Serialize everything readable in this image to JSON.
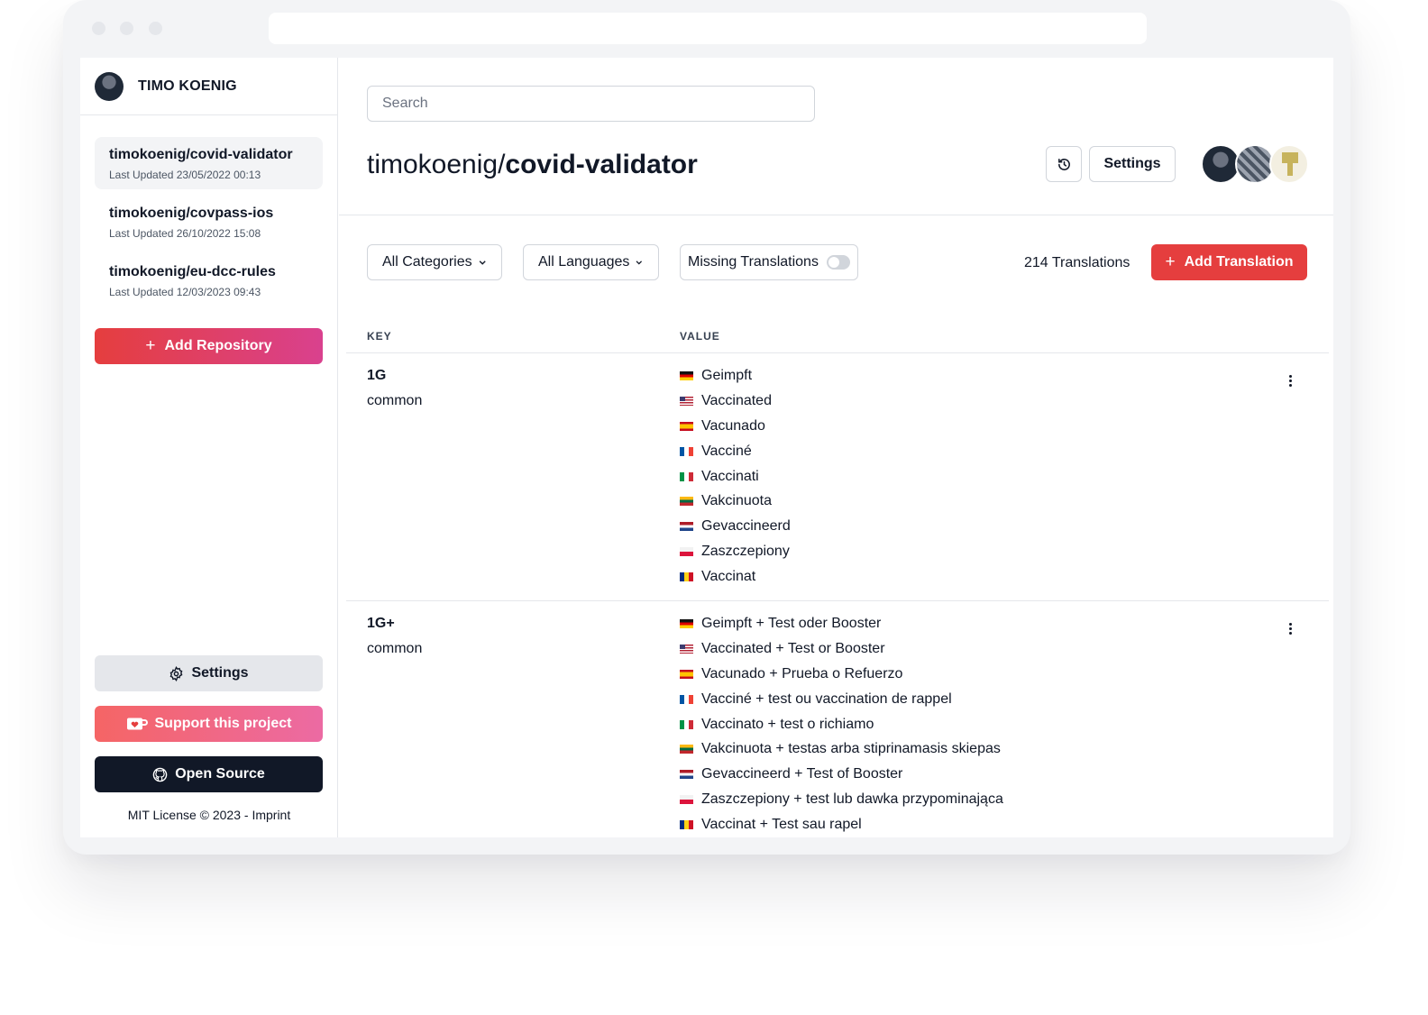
{
  "user": {
    "name": "TIMO KOENIG"
  },
  "sidebar": {
    "repos": [
      {
        "name": "timokoenig/covid-validator",
        "updated": "Last Updated 23/05/2022 00:13",
        "active": true
      },
      {
        "name": "timokoenig/covpass-ios",
        "updated": "Last Updated 26/10/2022 15:08",
        "active": false
      },
      {
        "name": "timokoenig/eu-dcc-rules",
        "updated": "Last Updated 12/03/2023 09:43",
        "active": false
      }
    ],
    "add_repository": "Add Repository",
    "settings": "Settings",
    "support": "Support this project",
    "open_source": "Open Source",
    "license": "MIT License © 2023 - Imprint"
  },
  "main": {
    "search_placeholder": "Search",
    "title_owner": "timokoenig/",
    "title_repo": "covid-validator",
    "settings": "Settings",
    "filters": {
      "categories": "All Categories",
      "languages": "All Languages",
      "missing": "Missing Translations"
    },
    "count": "214 Translations",
    "add_translation": "Add Translation",
    "columns": {
      "key": "KEY",
      "value": "VALUE"
    }
  },
  "colors": {
    "primary": "#e53e3e",
    "accent_pink": "#d9418e",
    "dark": "#111827"
  },
  "translations": [
    {
      "key": "1G",
      "category": "common",
      "values": [
        {
          "lang": "de",
          "text": "Geimpft"
        },
        {
          "lang": "us",
          "text": "Vaccinated"
        },
        {
          "lang": "es",
          "text": "Vacunado"
        },
        {
          "lang": "fr",
          "text": "Vacciné"
        },
        {
          "lang": "it",
          "text": "Vaccinati"
        },
        {
          "lang": "lt",
          "text": "Vakcinuota"
        },
        {
          "lang": "nl",
          "text": "Gevaccineerd"
        },
        {
          "lang": "pl",
          "text": "Zaszczepiony"
        },
        {
          "lang": "ro",
          "text": "Vaccinat"
        }
      ]
    },
    {
      "key": "1G+",
      "category": "common",
      "values": [
        {
          "lang": "de",
          "text": "Geimpft + Test oder Booster"
        },
        {
          "lang": "us",
          "text": "Vaccinated + Test or Booster"
        },
        {
          "lang": "es",
          "text": "Vacunado + Prueba o Refuerzo"
        },
        {
          "lang": "fr",
          "text": "Vacciné + test ou vaccination de rappel"
        },
        {
          "lang": "it",
          "text": "Vaccinato + test o richiamo"
        },
        {
          "lang": "lt",
          "text": "Vakcinuota + testas arba stiprinamasis skiepas"
        },
        {
          "lang": "nl",
          "text": "Gevaccineerd + Test of Booster"
        },
        {
          "lang": "pl",
          "text": "Zaszczepiony + test lub dawka przypominająca"
        },
        {
          "lang": "ro",
          "text": "Vaccinat + Test sau rapel"
        }
      ]
    }
  ]
}
